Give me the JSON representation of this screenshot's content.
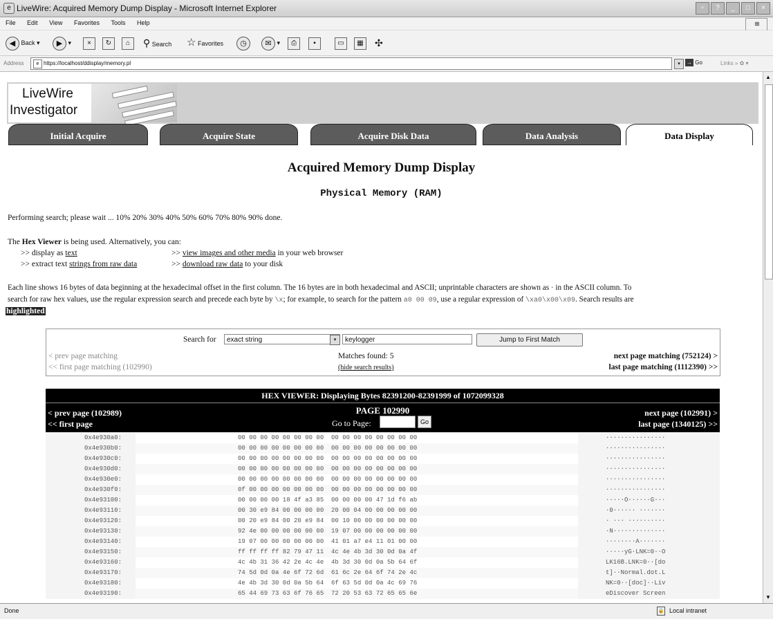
{
  "window": {
    "title": "LiveWire: Acquired Memory Dump Display - Microsoft Internet Explorer",
    "icon_name": "ie-icon"
  },
  "menu": [
    "File",
    "Edit",
    "View",
    "Favorites",
    "Tools",
    "Help"
  ],
  "toolbar": {
    "back": "Back",
    "search": "Search",
    "favorites": "Favorites"
  },
  "address": {
    "label": "Address",
    "url": "https://localhost/ddisplay/memory.pl",
    "go": "Go",
    "links": "Links"
  },
  "status": {
    "left": "Done",
    "zone": "Local intranet"
  },
  "banner": {
    "logo_line1": "LiveWire",
    "logo_line2": "Investigator"
  },
  "tabs": [
    {
      "label": "Initial Acquire"
    },
    {
      "label": "Acquire State"
    },
    {
      "label": "Acquire Disk Data"
    },
    {
      "label": "Data Analysis"
    },
    {
      "label": "Data Display",
      "active": true
    }
  ],
  "page": {
    "title": "Acquired Memory Dump Display",
    "subtitle": "Physical Memory (RAM)",
    "progress": "Performing search; please wait ... 10% 20% 30% 40% 50% 60% 70% 80% 90% done.",
    "intro_a": "The ",
    "intro_b": "Hex Viewer",
    "intro_c": " is being used. Alternatively, you can:",
    "opt1_pre": ">> display as ",
    "opt1_link": "text",
    "opt2_pre": ">> extract text ",
    "opt2_link": "strings from raw data",
    "opt3_pre": ">> ",
    "opt3_link": "view images and other media",
    "opt3_post": " in your web browser",
    "opt4_pre": ">> ",
    "opt4_link": "download raw data",
    "opt4_post": " to your disk",
    "desc1": "Each line shows 16 bytes of data beginning at the hexadecimal offset in the first column. The 16 bytes are in both hexadecimal and ASCII; unprintable characters are shown as · in the ASCII column. To",
    "desc2a": "search for raw hex values, use the regular expression search and precede each byte by ",
    "desc2b": "\\x",
    "desc2c": "; for example, to search for the pattern ",
    "desc2d": "a0 00 09",
    "desc2e": ", use a regular expression of ",
    "desc2f": "\\xa0\\x00\\x09",
    "desc2g": ". Search results are",
    "desc3": "highlighted"
  },
  "search": {
    "label": "Search for",
    "mode": "exact string",
    "query": "keylogger",
    "button": "Jump to First Match",
    "prev": "< prev page matching",
    "first": "<< first page matching (102990)",
    "matches": "Matches found: 5",
    "hide": "(hide search results)",
    "next": "next page matching (752124) >",
    "last": "last page matching (1112390) >>"
  },
  "hexviewer": {
    "header": "HEX VIEWER: Displaying Bytes 82391200-82391999 of 1072099328",
    "prev": "< prev page (102989)",
    "first": "<< first page",
    "page": "PAGE 102990",
    "goto": "Go to Page:",
    "go": "Go",
    "next": "next page (102991) >",
    "last": "last page (1340125) >>",
    "rows": [
      {
        "off": "0x4e930a0:",
        "hex": "00 00 00 00 00 00 00 00  00 00 00 00 00 00 00 00",
        "asc": "················"
      },
      {
        "off": "0x4e930b0:",
        "hex": "00 00 00 00 00 00 00 00  00 00 00 00 00 00 00 00",
        "asc": "················"
      },
      {
        "off": "0x4e930c0:",
        "hex": "00 00 00 00 00 00 00 00  00 00 00 00 00 00 00 00",
        "asc": "················"
      },
      {
        "off": "0x4e930d0:",
        "hex": "00 00 00 00 00 00 00 00  00 00 00 00 00 00 00 00",
        "asc": "················"
      },
      {
        "off": "0x4e930e0:",
        "hex": "00 00 00 00 00 00 00 00  00 00 00 00 00 00 00 00",
        "asc": "················"
      },
      {
        "off": "0x4e930f0:",
        "hex": "0f 00 00 00 00 00 00 00  00 00 00 00 00 00 00 00",
        "asc": "················"
      },
      {
        "off": "0x4e93100:",
        "hex": "00 00 00 00 18 4f a3 85  00 00 00 00 47 1d f6 ab",
        "asc": "·····O······G···"
      },
      {
        "off": "0x4e93110:",
        "hex": "00 30 e9 84 00 00 00 00  20 00 04 00 00 00 00 00",
        "asc": "·0······ ·······"
      },
      {
        "off": "0x4e93120:",
        "hex": "00 20 e9 84 00 20 e9 84  00 10 00 00 00 00 00 00",
        "asc": "· ··· ··········"
      },
      {
        "off": "0x4e93130:",
        "hex": "92 4e 00 00 00 00 00 00  19 07 00 00 00 00 00 00",
        "asc": "·N··············"
      },
      {
        "off": "0x4e93140:",
        "hex": "19 07 00 00 00 00 00 00  41 01 a7 e4 11 01 00 00",
        "asc": "········A·······"
      },
      {
        "off": "0x4e93150:",
        "hex": "ff ff ff ff 82 79 47 11  4c 4e 4b 3d 30 0d 0a 4f",
        "asc": "·····yG·LNK=0··O"
      },
      {
        "off": "0x4e93160:",
        "hex": "4c 4b 31 36 42 2e 4c 4e  4b 3d 30 0d 0a 5b 64 6f",
        "asc": "LK16B.LNK=0··[do"
      },
      {
        "off": "0x4e93170:",
        "hex": "74 5d 0d 0a 4e 6f 72 6d  61 6c 2e 64 6f 74 2e 4c",
        "asc": "t]··Normal.dot.L"
      },
      {
        "off": "0x4e93180:",
        "hex": "4e 4b 3d 30 0d 0a 5b 64  6f 63 5d 0d 0a 4c 69 76",
        "asc": "NK=0··[doc]··Liv"
      },
      {
        "off": "0x4e93190:",
        "hex": "65 44 69 73 63 6f 76 65  72 20 53 63 72 65 65 6e",
        "asc": "eDiscover Screen"
      }
    ]
  }
}
